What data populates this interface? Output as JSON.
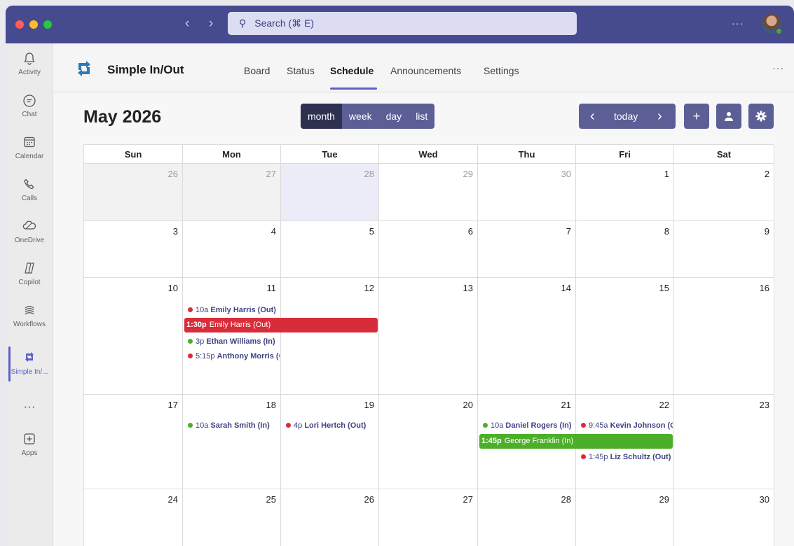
{
  "titlebar": {
    "search_placeholder": "Search (⌘ E)",
    "more": "···"
  },
  "rail": [
    {
      "label": "Activity",
      "icon": "bell-icon"
    },
    {
      "label": "Chat",
      "icon": "chat-icon"
    },
    {
      "label": "Calendar",
      "icon": "calendar-icon"
    },
    {
      "label": "Calls",
      "icon": "phone-icon"
    },
    {
      "label": "OneDrive",
      "icon": "cloud-icon"
    },
    {
      "label": "Copilot",
      "icon": "copilot-icon"
    },
    {
      "label": "Workflows",
      "icon": "workflows-icon"
    },
    {
      "label": "Simple In/...",
      "icon": "simple-inout-icon",
      "active": true
    },
    {
      "label": "···",
      "icon": "more-icon"
    },
    {
      "label": "Apps",
      "icon": "apps-icon"
    }
  ],
  "app": {
    "title": "Simple In/Out",
    "tabs": [
      "Board",
      "Status",
      "Schedule",
      "Announcements",
      "Settings"
    ],
    "active_tab": "Schedule",
    "more": "···"
  },
  "toolbar": {
    "month_title": "May 2026",
    "views": [
      "month",
      "week",
      "day",
      "list"
    ],
    "active_view": "month",
    "prev": "‹",
    "today": "today",
    "next": "›",
    "add": "+",
    "colors": {
      "button": "#5b5f96",
      "active": "#2f3150"
    }
  },
  "calendar": {
    "weekdays": [
      "Sun",
      "Mon",
      "Tue",
      "Wed",
      "Thu",
      "Fri",
      "Sat"
    ],
    "weeks": [
      [
        "26",
        "27",
        "28",
        "29",
        "30",
        "1",
        "2"
      ],
      [
        "3",
        "4",
        "5",
        "6",
        "7",
        "8",
        "9"
      ],
      [
        "10",
        "11",
        "12",
        "13",
        "14",
        "15",
        "16"
      ],
      [
        "17",
        "18",
        "19",
        "20",
        "21",
        "22",
        "23"
      ],
      [
        "24",
        "25",
        "26",
        "27",
        "28",
        "29",
        "30"
      ]
    ],
    "events": {
      "e1": {
        "time": "10a",
        "name": "Emily Harris (Out)",
        "status": "out"
      },
      "e2": {
        "time": "1:30p",
        "name": "Emily Harris (Out)",
        "status": "out"
      },
      "e3": {
        "time": "3p",
        "name": "Ethan Williams (In)",
        "status": "in"
      },
      "e4": {
        "time": "5:15p",
        "name": "Anthony Morris (Out)",
        "status": "out"
      },
      "e5": {
        "time": "10a",
        "name": "Sarah Smith (In)",
        "status": "in"
      },
      "e6": {
        "time": "4p",
        "name": "Lori Hertch (Out)",
        "status": "out"
      },
      "e7": {
        "time": "10a",
        "name": "Daniel Rogers (In)",
        "status": "in"
      },
      "e8": {
        "time": "9:45a",
        "name": "Kevin Johnson (Out)",
        "status": "out"
      },
      "e9": {
        "time": "1:45p",
        "name": "George Franklin (In)",
        "status": "in"
      },
      "e10": {
        "time": "1:45p",
        "name": "Liz Schultz (Out)",
        "status": "out"
      }
    },
    "colors": {
      "out": "#d92c3a",
      "in": "#4caf2a"
    }
  }
}
